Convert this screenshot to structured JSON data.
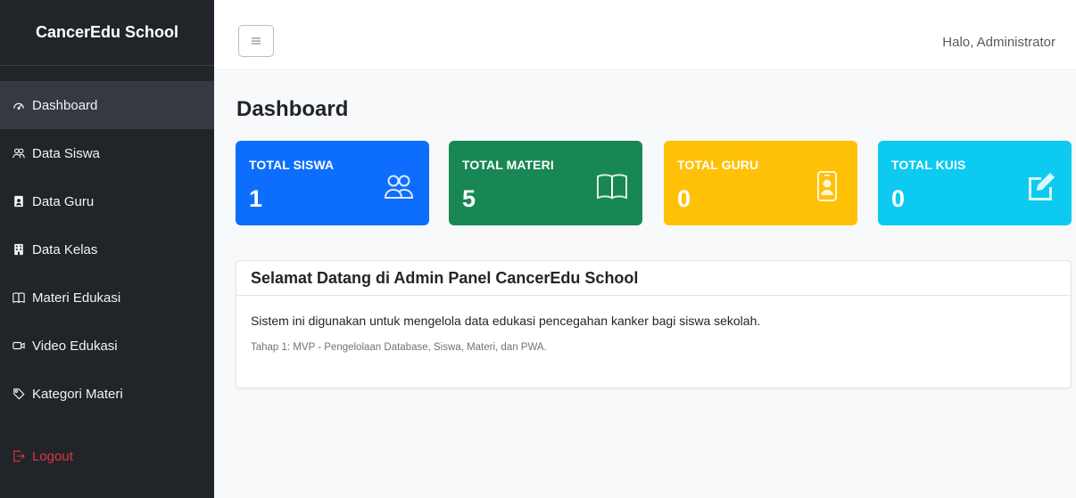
{
  "sidebar": {
    "brand": "CancerEdu School",
    "items": [
      {
        "label": "Dashboard",
        "icon": "speedometer-icon"
      },
      {
        "label": "Data Siswa",
        "icon": "people-icon"
      },
      {
        "label": "Data Guru",
        "icon": "person-badge-icon"
      },
      {
        "label": "Data Kelas",
        "icon": "building-icon"
      },
      {
        "label": "Materi Edukasi",
        "icon": "book-icon"
      },
      {
        "label": "Video Edukasi",
        "icon": "camera-video-icon"
      },
      {
        "label": "Kategori Materi",
        "icon": "tag-icon"
      }
    ],
    "logout": {
      "label": "Logout",
      "icon": "box-arrow-right-icon"
    }
  },
  "topbar": {
    "toggle_icon": "hamburger-menu-icon",
    "greeting": "Halo, Administrator"
  },
  "main": {
    "title": "Dashboard",
    "cards": [
      {
        "label": "TOTAL SISWA",
        "value": "1",
        "icon": "people-icon",
        "color": "#0d6efd"
      },
      {
        "label": "TOTAL MATERI",
        "value": "5",
        "icon": "book-icon",
        "color": "#198754"
      },
      {
        "label": "TOTAL GURU",
        "value": "0",
        "icon": "person-badge-icon",
        "color": "#ffc107"
      },
      {
        "label": "TOTAL KUIS",
        "value": "0",
        "icon": "pencil-square-icon",
        "color": "#0dcaf0"
      }
    ],
    "welcome": {
      "title": "Selamat Datang di Admin Panel CancerEdu School",
      "description": "Sistem ini digunakan untuk mengelola data edukasi pencegahan kanker bagi siswa sekolah.",
      "stage": "Tahap 1: MVP - Pengelolaan Database, Siswa, Materi, dan PWA."
    }
  },
  "colors": {
    "sidebar_bg": "#212529",
    "sidebar_active": "#343a40",
    "logout": "#dc3545",
    "main_bg": "#f8f9fa"
  }
}
